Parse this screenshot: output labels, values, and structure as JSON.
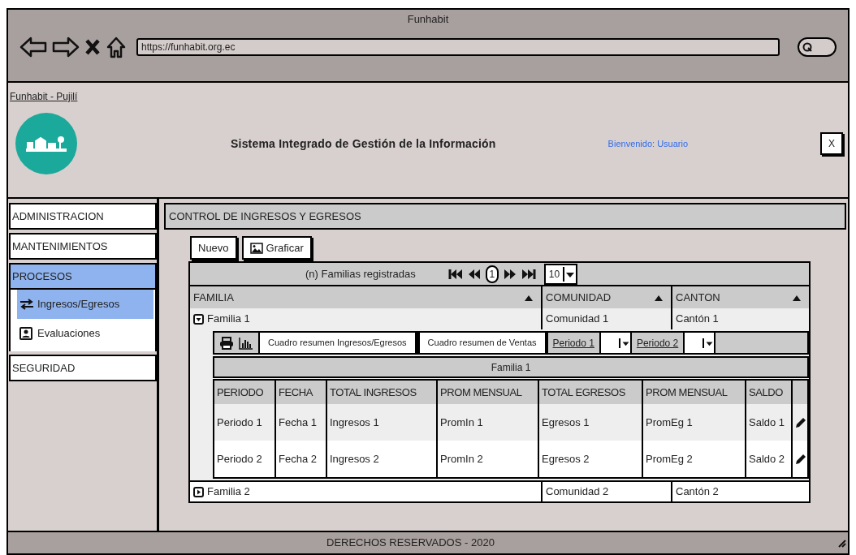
{
  "browser": {
    "title": "Funhabit",
    "url": "https://funhabit.org.ec"
  },
  "header": {
    "site_link": "Funhabit - Pujilí",
    "title": "Sistema Integrado de Gestión de la Información",
    "welcome": "Bienvenido: Usuario",
    "close": "X"
  },
  "sidebar": {
    "items": [
      {
        "label": "ADMINISTRACION",
        "selected": false
      },
      {
        "label": "MANTENIMIENTOS",
        "selected": false
      },
      {
        "label": "PROCESOS",
        "selected": true,
        "children": [
          {
            "label": "Ingresos/Egresos",
            "kind": "swap",
            "selected": true
          },
          {
            "label": "Evaluaciones",
            "kind": "person",
            "selected": false
          }
        ]
      },
      {
        "label": "SEGURIDAD",
        "selected": false
      }
    ]
  },
  "main": {
    "title": "CONTROL DE INGRESOS Y EGRESOS",
    "buttons": [
      {
        "label": "Nuevo",
        "kind": "plain"
      },
      {
        "label": "Graficar",
        "kind": "image"
      }
    ],
    "grid": {
      "caption": "(n) Familias registradas",
      "page": "1",
      "page_size": "10",
      "columns": [
        "FAMILIA",
        "COMUNIDAD",
        "CANTON"
      ],
      "rows": [
        {
          "familia": "Familia 1",
          "comunidad": "Comunidad 1",
          "canton": "Cantón 1",
          "expanded": true,
          "detail": {
            "tools": [
              "Cuadro resumen Ingresos/Egresos",
              "Cuadro resumen de Ventas"
            ],
            "periods": [
              "Periodo 1",
              "Periodo 2"
            ],
            "title": "Familia 1",
            "columns": [
              "PERIODO",
              "FECHA",
              "TOTAL INGRESOS",
              "PROM MENSUAL",
              "TOTAL EGRESOS",
              "PROM MENSUAL",
              "SALDO"
            ],
            "rows": [
              [
                "Periodo 1",
                "Fecha 1",
                "Ingresos 1",
                "PromIn 1",
                "Egresos 1",
                "PromEg 1",
                "Saldo 1"
              ],
              [
                "Periodo 2",
                "Fecha 2",
                "Ingresos 2",
                "PromIn 2",
                "Egresos 2",
                "PromEg 2",
                "Saldo 2"
              ]
            ]
          }
        },
        {
          "familia": "Familia 2",
          "comunidad": "Comunidad 2",
          "canton": "Cantón 2",
          "expanded": false
        }
      ]
    }
  },
  "footer": "DERECHOS RESERVADOS - 2020"
}
